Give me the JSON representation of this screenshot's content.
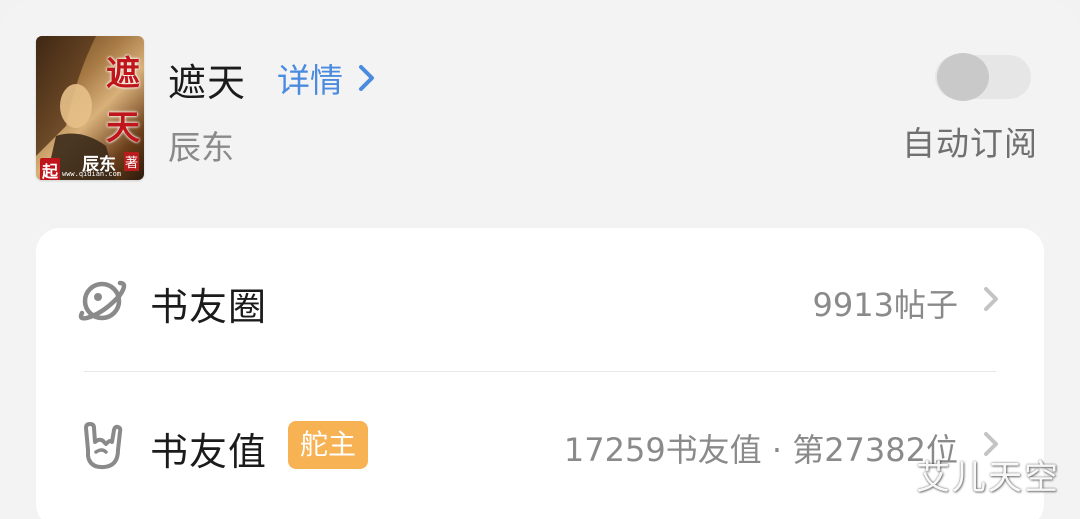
{
  "book": {
    "title": "遮天",
    "details_label": "详情",
    "author": "辰东",
    "cover": {
      "title_chars": [
        "遮",
        "天"
      ],
      "author_mark": "辰东",
      "publisher_mark": "起",
      "suffix_mark": "著",
      "site_text": "www.qidian.com"
    }
  },
  "auto_subscribe": {
    "label": "自动订阅",
    "enabled": false
  },
  "rows": [
    {
      "label": "书友圈",
      "value": "9913帖子",
      "icon": "planet-icon"
    },
    {
      "label": "书友值",
      "badge": "舵主",
      "value": "17259书友值 · 第27382位",
      "icon": "rock-hand-icon"
    }
  ],
  "watermark": "艾儿天空",
  "colors": {
    "accent_blue": "#4a8be0",
    "badge_orange": "#f6b253",
    "text_primary": "#1b1b1b",
    "text_secondary": "#8a8a8a"
  }
}
